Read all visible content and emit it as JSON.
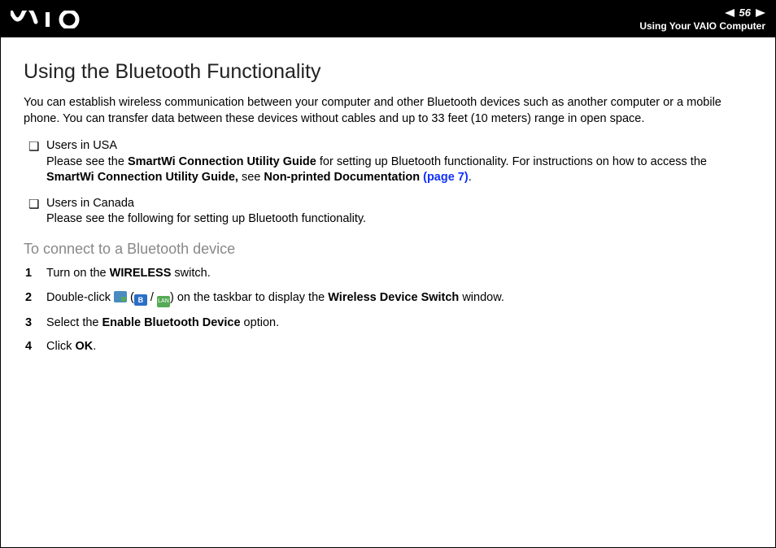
{
  "header": {
    "page_number": "56",
    "section_label": "Using Your VAIO Computer"
  },
  "content": {
    "title": "Using the Bluetooth Functionality",
    "intro": "You can establish wireless communication between your computer and other Bluetooth devices such as another computer or a mobile phone. You can transfer data between these devices without cables and up to 33 feet (10 meters) range in open space.",
    "bullets": [
      {
        "heading": "Users in USA",
        "text_before_bold1": "Please see the ",
        "bold1": "SmartWi Connection Utility Guide",
        "text_mid": " for setting up Bluetooth functionality. For instructions on how to access the ",
        "bold2": "SmartWi Connection Utility Guide,",
        "text_after_bold2": " see ",
        "bold3": "Non-printed Documentation ",
        "link": "(page 7)",
        "tail": "."
      },
      {
        "heading": "Users in Canada",
        "text": "Please see the following for setting up Bluetooth functionality."
      }
    ],
    "subheading": "To connect to a Bluetooth device",
    "steps": [
      {
        "n": "1",
        "pre": "Turn on the ",
        "bold": "WIRELESS",
        "post": " switch."
      },
      {
        "n": "2",
        "pre": "Double-click ",
        "icons_segment": true,
        "mid": " on the taskbar to display the ",
        "bold": "Wireless Device Switch",
        "post": " window."
      },
      {
        "n": "3",
        "pre": "Select the ",
        "bold": "Enable Bluetooth Device",
        "post": " option."
      },
      {
        "n": "4",
        "pre": "Click ",
        "bold": "OK",
        "post": "."
      }
    ],
    "icon_labels": {
      "paren_open": "(",
      "slash": " / ",
      "paren_close": ")",
      "b": "B",
      "lan": "LAN"
    }
  }
}
